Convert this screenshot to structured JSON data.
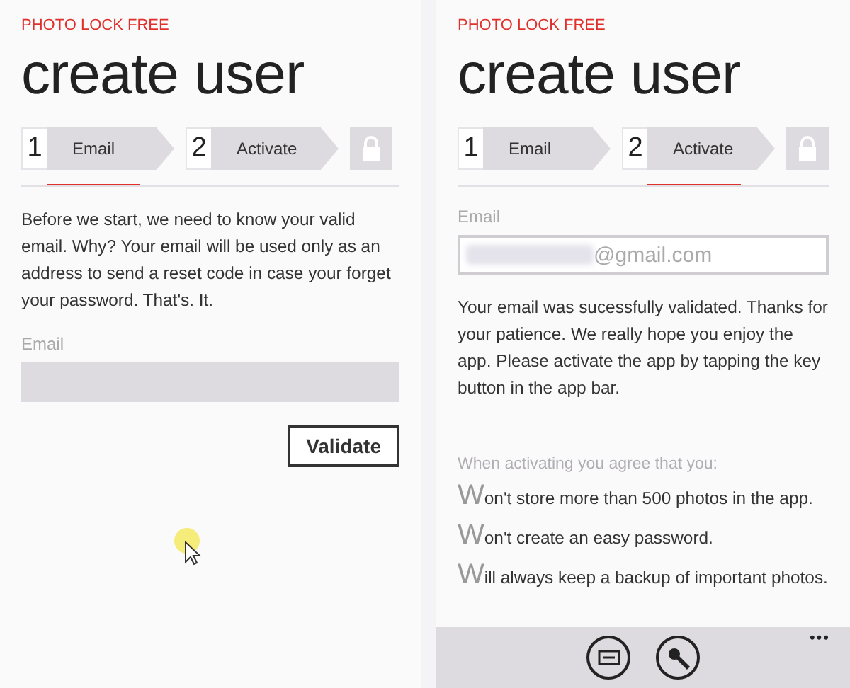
{
  "screens": [
    {
      "app_name": "PHOTO LOCK FREE",
      "title": "create user",
      "steps": [
        {
          "number": "1",
          "label": "Email",
          "selected": true
        },
        {
          "number": "2",
          "label": "Activate",
          "selected": false
        }
      ],
      "blocks": [
        {
          "kind": "paragraph",
          "text": "Before we start, we need to know your valid email. Why? Your email will be used only as an address to send a reset code in case your forget your password. That's. It."
        },
        {
          "kind": "field",
          "label": "Email",
          "disabled": false
        },
        {
          "kind": "button",
          "label": "Validate"
        }
      ],
      "cursor": true
    },
    {
      "app_name": "PHOTO LOCK FREE",
      "title": "create user",
      "steps": [
        {
          "number": "1",
          "label": "Email",
          "selected": false
        },
        {
          "number": "2",
          "label": "Activate",
          "selected": true
        }
      ],
      "blocks": [
        {
          "kind": "field",
          "label": "Email",
          "value": "@gmail.com",
          "redacted": true,
          "disabled": true
        },
        {
          "kind": "paragraph",
          "text": "Your email was sucessfully validated. Thanks for your patience. We really hope you enjoy the app. Please activate the app by tapping the key button in the app bar."
        },
        {
          "kind": "agreement",
          "heading": "When activating you agree that you:",
          "items": [
            "Won't store more than 500 photos in the app.",
            "Won't create an easy password.",
            "Will always keep a backup of important photos."
          ]
        }
      ],
      "app_bar": {
        "more": "•••"
      }
    }
  ]
}
